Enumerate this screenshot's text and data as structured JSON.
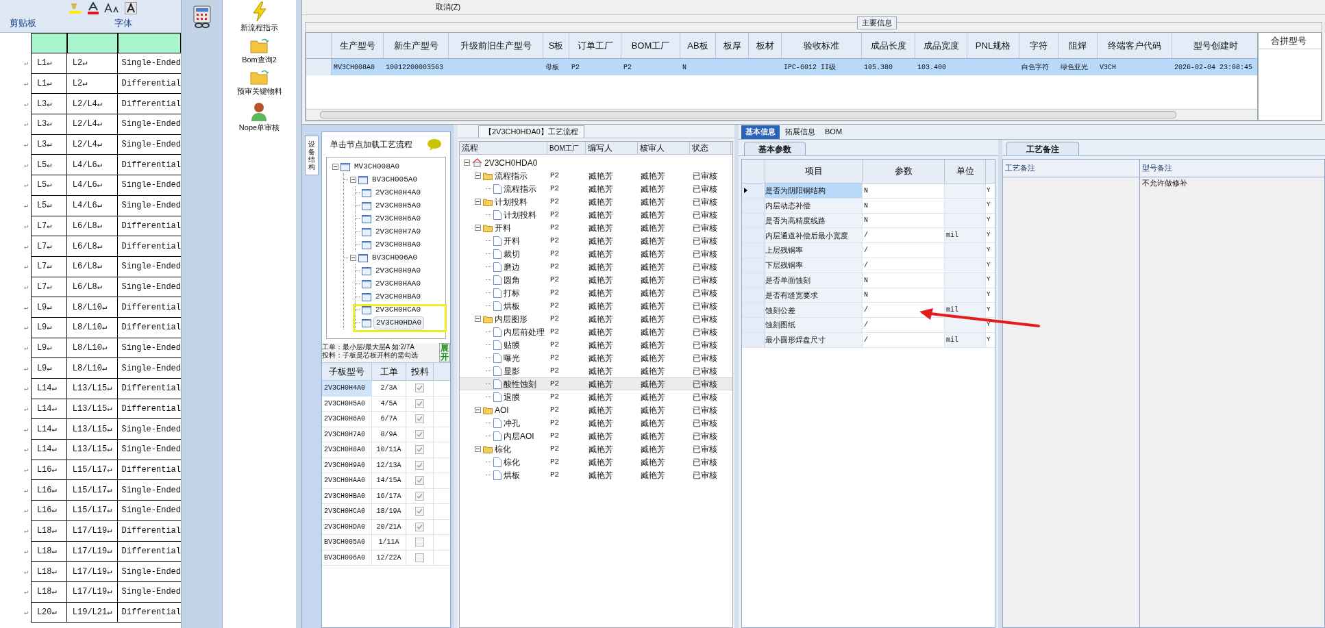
{
  "excel": {
    "ribbon_groups": [
      {
        "label": "剪贴板"
      },
      {
        "label": "字体"
      }
    ],
    "rows": [
      {
        "mark": "↵",
        "cells": [
          "L1↵",
          "L2↵",
          "Single-Ended"
        ]
      },
      {
        "mark": "↵",
        "cells": [
          "L1↵",
          "L2↵",
          "Differential"
        ]
      },
      {
        "mark": "↵",
        "cells": [
          "L3↵",
          "L2/L4↵",
          "Differential"
        ]
      },
      {
        "mark": "↵",
        "cells": [
          "L3↵",
          "L2/L4↵",
          "Single-Ended"
        ]
      },
      {
        "mark": "↵",
        "cells": [
          "L3↵",
          "L2/L4↵",
          "Single-Ended"
        ]
      },
      {
        "mark": "↵",
        "cells": [
          "L5↵",
          "L4/L6↵",
          "Differential"
        ]
      },
      {
        "mark": "↵",
        "cells": [
          "L5↵",
          "L4/L6↵",
          "Single-Ended"
        ]
      },
      {
        "mark": "↵",
        "cells": [
          "L5↵",
          "L4/L6↵",
          "Single-Ended"
        ]
      },
      {
        "mark": "↵",
        "cells": [
          "L7↵",
          "L6/L8↵",
          "Differential"
        ]
      },
      {
        "mark": "↵",
        "cells": [
          "L7↵",
          "L6/L8↵",
          "Differential"
        ]
      },
      {
        "mark": "↵",
        "cells": [
          "L7↵",
          "L6/L8↵",
          "Single-Ended"
        ]
      },
      {
        "mark": "↵",
        "cells": [
          "L7↵",
          "L6/L8↵",
          "Single-Ended"
        ]
      },
      {
        "mark": "↵",
        "cells": [
          "L9↵",
          "L8/L10↵",
          "Differential"
        ]
      },
      {
        "mark": "↵",
        "cells": [
          "L9↵",
          "L8/L10↵",
          "Differential"
        ]
      },
      {
        "mark": "↵",
        "cells": [
          "L9↵",
          "L8/L10↵",
          "Single-Ended"
        ]
      },
      {
        "mark": "↵",
        "cells": [
          "L9↵",
          "L8/L10↵",
          "Single-Ended"
        ]
      },
      {
        "mark": "↵",
        "cells": [
          "L14↵",
          "L13/L15↵",
          "Differential"
        ]
      },
      {
        "mark": "↵",
        "cells": [
          "L14↵",
          "L13/L15↵",
          "Differential"
        ]
      },
      {
        "mark": "↵",
        "cells": [
          "L14↵",
          "L13/L15↵",
          "Single-Ended"
        ]
      },
      {
        "mark": "↵",
        "cells": [
          "L14↵",
          "L13/L15↵",
          "Single-Ended"
        ]
      },
      {
        "mark": "↵",
        "cells": [
          "L16↵",
          "L15/L17↵",
          "Differential"
        ]
      },
      {
        "mark": "↵",
        "cells": [
          "L16↵",
          "L15/L17↵",
          "Single-Ended"
        ]
      },
      {
        "mark": "↵",
        "cells": [
          "L16↵",
          "L15/L17↵",
          "Single-Ended"
        ]
      },
      {
        "mark": "↵",
        "cells": [
          "L18↵",
          "L17/L19↵",
          "Differential"
        ]
      },
      {
        "mark": "↵",
        "cells": [
          "L18↵",
          "L17/L19↵",
          "Differential"
        ]
      },
      {
        "mark": "↵",
        "cells": [
          "L18↵",
          "L17/L19↵",
          "Single-Ended"
        ]
      },
      {
        "mark": "↵",
        "cells": [
          "L18↵",
          "L17/L19↵",
          "Single-Ended"
        ]
      },
      {
        "mark": "↵",
        "cells": [
          "L20↵",
          "L19/L21↵",
          "Differential"
        ]
      }
    ]
  },
  "nav": [
    {
      "kind": "lightning",
      "label": "新流程指示"
    },
    {
      "kind": "folder",
      "label": "Bom查询2"
    },
    {
      "kind": "folder",
      "label": "预审关键物料"
    },
    {
      "kind": "person",
      "label": "Nope单审核"
    }
  ],
  "toolbar": {
    "cancel": "取消(Z)"
  },
  "main_info": {
    "title": "主要信息",
    "columns": [
      "生产型号",
      "新生产型号",
      "升级前旧生产型号",
      "S板",
      "订单工厂",
      "BOM工厂",
      "AB板",
      "板厚",
      "板材",
      "验收标准",
      "成品长度",
      "成品宽度",
      "PNL规格",
      "字符",
      "阻焊",
      "终端客户代码",
      "型号创建时"
    ],
    "rows": [
      {
        "selected": true,
        "cells": [
          "MV3CH008A0",
          "10012200003563",
          "",
          "母板",
          "P2",
          "P2",
          "N",
          "",
          "",
          "IPC-6012 II级",
          "105.380",
          "103.400",
          "",
          "白色字符",
          "绿色亚光",
          "V3CH",
          "2026-02-04 23:08:45"
        ]
      }
    ],
    "side_column": "合拼型号"
  },
  "structure": {
    "side_tab": "设备结构",
    "title": "单击节点加载工艺流程",
    "tree": [
      {
        "name": "MV3CH008A0",
        "selected": false,
        "children": [
          {
            "name": "BV3CH005A0",
            "selected": false,
            "children": [
              {
                "name": "2V3CH0H4A0",
                "selected": false
              },
              {
                "name": "2V3CH0H5A0",
                "selected": false
              },
              {
                "name": "2V3CH0H6A0",
                "selected": false
              },
              {
                "name": "2V3CH0H7A0",
                "selected": false
              },
              {
                "name": "2V3CH0H8A0",
                "selected": false
              }
            ]
          },
          {
            "name": "BV3CH006A0",
            "selected": false,
            "children": [
              {
                "name": "2V3CH0H9A0",
                "selected": false
              },
              {
                "name": "2V3CH0HAA0",
                "selected": false
              },
              {
                "name": "2V3CH0HBA0",
                "selected": false
              },
              {
                "name": "2V3CH0HCA0",
                "selected": false
              },
              {
                "name": "2V3CH0HDA0",
                "selected": true
              }
            ]
          }
        ]
      }
    ],
    "hints": [
      "工单：最小层/最大层A 如:2/7A",
      "投料：子板是芯板开料的需勾选"
    ],
    "expand_button": "展开",
    "columns": [
      "子板型号",
      "工单",
      "投料"
    ],
    "rows": [
      {
        "board": "2V3CH0H4A0",
        "order": "2/3A",
        "checked": true,
        "selected": true
      },
      {
        "board": "2V3CH0H5A0",
        "order": "4/5A",
        "checked": true,
        "selected": false
      },
      {
        "board": "2V3CH0H6A0",
        "order": "6/7A",
        "checked": true,
        "selected": false
      },
      {
        "board": "2V3CH0H7A0",
        "order": "8/9A",
        "checked": true,
        "selected": false
      },
      {
        "board": "2V3CH0H8A0",
        "order": "10/11A",
        "checked": true,
        "selected": false
      },
      {
        "board": "2V3CH0H9A0",
        "order": "12/13A",
        "checked": true,
        "selected": false
      },
      {
        "board": "2V3CH0HAA0",
        "order": "14/15A",
        "checked": true,
        "selected": false
      },
      {
        "board": "2V3CH0HBA0",
        "order": "16/17A",
        "checked": true,
        "selected": false
      },
      {
        "board": "2V3CH0HCA0",
        "order": "18/19A",
        "checked": true,
        "selected": false
      },
      {
        "board": "2V3CH0HDA0",
        "order": "20/21A",
        "checked": true,
        "selected": false
      },
      {
        "board": "BV3CH005A0",
        "order": "1/11A",
        "checked": false,
        "selected": false
      },
      {
        "board": "BV3CH006A0",
        "order": "12/22A",
        "checked": false,
        "selected": false
      }
    ]
  },
  "flow": {
    "title": "【2V3CH0HDA0】工艺流程",
    "columns": [
      "流程",
      "BOM工厂",
      "编写人",
      "核审人",
      "状态"
    ],
    "root": {
      "name": "2V3CH0HDA0",
      "children": [
        {
          "name": "流程指示",
          "cells": [
            "P2",
            "臧艳芳",
            "臧艳芳",
            "已审核"
          ],
          "selected": false,
          "children": [
            {
              "name": "流程指示",
              "cells": [
                "P2",
                "臧艳芳",
                "臧艳芳",
                "已审核"
              ],
              "selected": false
            }
          ]
        },
        {
          "name": "计划投料",
          "cells": [
            "P2",
            "臧艳芳",
            "臧艳芳",
            "已审核"
          ],
          "selected": false,
          "children": [
            {
              "name": "计划投料",
              "cells": [
                "P2",
                "臧艳芳",
                "臧艳芳",
                "已审核"
              ],
              "selected": false
            }
          ]
        },
        {
          "name": "开料",
          "cells": [
            "P2",
            "臧艳芳",
            "臧艳芳",
            "已审核"
          ],
          "selected": false,
          "children": [
            {
              "name": "开料",
              "cells": [
                "P2",
                "臧艳芳",
                "臧艳芳",
                "已审核"
              ],
              "selected": false
            },
            {
              "name": "裁切",
              "cells": [
                "P2",
                "臧艳芳",
                "臧艳芳",
                "已审核"
              ],
              "selected": false
            },
            {
              "name": "磨边",
              "cells": [
                "P2",
                "臧艳芳",
                "臧艳芳",
                "已审核"
              ],
              "selected": false
            },
            {
              "name": "圆角",
              "cells": [
                "P2",
                "臧艳芳",
                "臧艳芳",
                "已审核"
              ],
              "selected": false
            },
            {
              "name": "打标",
              "cells": [
                "P2",
                "臧艳芳",
                "臧艳芳",
                "已审核"
              ],
              "selected": false
            },
            {
              "name": "烘板",
              "cells": [
                "P2",
                "臧艳芳",
                "臧艳芳",
                "已审核"
              ],
              "selected": false
            }
          ]
        },
        {
          "name": "内层图形",
          "cells": [
            "P2",
            "臧艳芳",
            "臧艳芳",
            "已审核"
          ],
          "selected": false,
          "children": [
            {
              "name": "内层前处理",
              "cells": [
                "P2",
                "臧艳芳",
                "臧艳芳",
                "已审核"
              ],
              "selected": false
            },
            {
              "name": "贴膜",
              "cells": [
                "P2",
                "臧艳芳",
                "臧艳芳",
                "已审核"
              ],
              "selected": false
            },
            {
              "name": "曝光",
              "cells": [
                "P2",
                "臧艳芳",
                "臧艳芳",
                "已审核"
              ],
              "selected": false
            },
            {
              "name": "显影",
              "cells": [
                "P2",
                "臧艳芳",
                "臧艳芳",
                "已审核"
              ],
              "selected": false
            },
            {
              "name": "酸性蚀刻",
              "cells": [
                "P2",
                "臧艳芳",
                "臧艳芳",
                "已审核"
              ],
              "selected": true
            },
            {
              "name": "退膜",
              "cells": [
                "P2",
                "臧艳芳",
                "臧艳芳",
                "已审核"
              ],
              "selected": false
            }
          ]
        },
        {
          "name": "AOI",
          "cells": [
            "P2",
            "臧艳芳",
            "臧艳芳",
            "已审核"
          ],
          "selected": false,
          "children": [
            {
              "name": "冲孔",
              "cells": [
                "P2",
                "臧艳芳",
                "臧艳芳",
                "已审核"
              ],
              "selected": false
            },
            {
              "name": "内层AOI",
              "cells": [
                "P2",
                "臧艳芳",
                "臧艳芳",
                "已审核"
              ],
              "selected": false
            }
          ]
        },
        {
          "name": "棕化",
          "cells": [
            "P2",
            "臧艳芳",
            "臧艳芳",
            "已审核"
          ],
          "selected": false,
          "children": [
            {
              "name": "棕化",
              "cells": [
                "P2",
                "臧艳芳",
                "臧艳芳",
                "已审核"
              ],
              "selected": false
            },
            {
              "name": "烘板",
              "cells": [
                "P2",
                "臧艳芳",
                "臧艳芳",
                "已审核"
              ],
              "selected": false
            }
          ]
        }
      ]
    }
  },
  "detail_tabs": [
    {
      "label": "基本信息",
      "selected": true
    },
    {
      "label": "拓展信息",
      "selected": false
    },
    {
      "label": "BOM",
      "selected": false
    }
  ],
  "params": {
    "tab": "基本参数",
    "columns": [
      "项目",
      "参数",
      "单位"
    ],
    "rows": [
      {
        "item": "是否为阴阳铜结构",
        "value": "N",
        "unit": "",
        "flag": "Y",
        "selected": true
      },
      {
        "item": "内层动态补偿",
        "value": "N",
        "unit": "",
        "flag": "Y",
        "selected": false
      },
      {
        "item": "是否为高精度线路",
        "value": "N",
        "unit": "",
        "flag": "Y",
        "selected": false
      },
      {
        "item": "内层通道补偿后最小宽度",
        "value": "/",
        "unit": "mil",
        "flag": "Y",
        "selected": false
      },
      {
        "item": "上层残铜率",
        "value": "/",
        "unit": "",
        "flag": "Y",
        "selected": false
      },
      {
        "item": "下层残铜率",
        "value": "/",
        "unit": "",
        "flag": "Y",
        "selected": false
      },
      {
        "item": "是否单面蚀刻",
        "value": "N",
        "unit": "",
        "flag": "Y",
        "selected": false
      },
      {
        "item": "是否有缝宽要求",
        "value": "N",
        "unit": "",
        "flag": "Y",
        "selected": false
      },
      {
        "item": "蚀刻公差",
        "value": "/",
        "unit": "mil",
        "flag": "Y",
        "selected": false
      },
      {
        "item": "蚀刻图纸",
        "value": "/",
        "unit": "",
        "flag": "Y",
        "selected": false
      },
      {
        "item": "最小圆形焊盘尺寸",
        "value": "/",
        "unit": "mil",
        "flag": "Y",
        "selected": false
      }
    ]
  },
  "notes": {
    "tab": "工艺备注",
    "columns": [
      "工艺备注",
      "型号备注"
    ],
    "model_note": "不允许做修补"
  }
}
